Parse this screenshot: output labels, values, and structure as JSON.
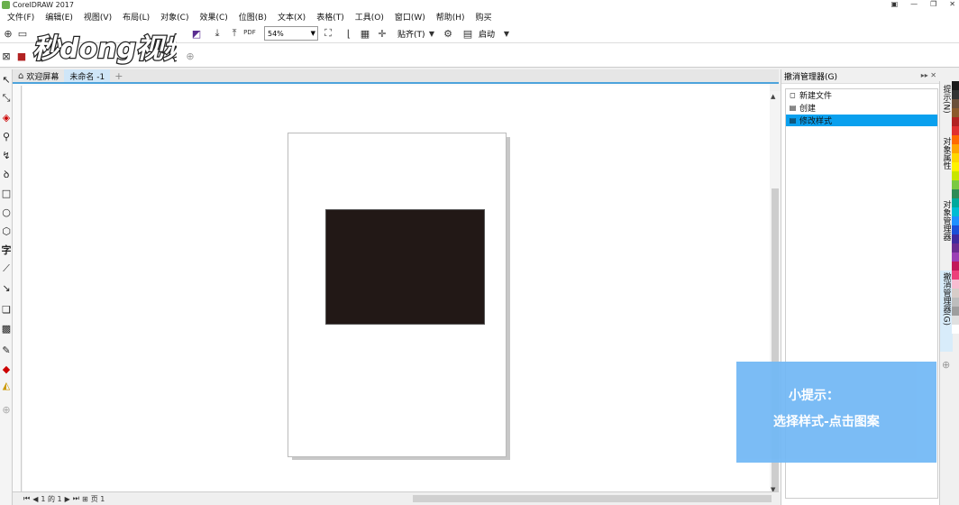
{
  "window": {
    "title": "CorelDRAW 2017"
  },
  "menubar": {
    "items": [
      "文件(F)",
      "编辑(E)",
      "视图(V)",
      "布局(L)",
      "对象(C)",
      "效果(C)",
      "位图(B)",
      "文本(X)",
      "表格(T)",
      "工具(O)",
      "窗口(W)",
      "帮助(H)",
      "购买"
    ]
  },
  "toolbar": {
    "zoom_value": "54%",
    "snap_label": "贴齐(T)",
    "launch_label": "启动",
    "pdf_label": "PDF"
  },
  "watermark": {
    "text": "秒dong视频"
  },
  "tabs": [
    {
      "label": "欢迎屏幕",
      "active": false
    },
    {
      "label": "未命名 -1",
      "active": true
    }
  ],
  "canvas": {
    "shape_color": "#221816",
    "page_color": "#ffffff"
  },
  "statusbar": {
    "page_nav": "1 的 1",
    "page_tab": "页 1"
  },
  "docker": {
    "title": "撤消管理器(G)",
    "undo_items": [
      {
        "label": "新建文件",
        "icon": "new-file-icon",
        "selected": false
      },
      {
        "label": "创建",
        "icon": "create-icon",
        "selected": false
      },
      {
        "label": "修改样式",
        "icon": "modify-style-icon",
        "selected": true
      }
    ]
  },
  "vertical_tabs": [
    {
      "label": "提示(N)",
      "active": false
    },
    {
      "label": "对象属性",
      "active": false
    },
    {
      "label": "对象管理器",
      "active": false
    },
    {
      "label": "撤消管理器(G)",
      "active": true
    }
  ],
  "palette": [
    "#1a1a1a",
    "#333333",
    "#6b4f3a",
    "#8b5a2b",
    "#b22222",
    "#e03030",
    "#ff6a00",
    "#ffa500",
    "#ffd700",
    "#fff200",
    "#c8e600",
    "#7ac943",
    "#2e8b57",
    "#00a99d",
    "#00bcd4",
    "#1e90ff",
    "#1b4fd8",
    "#3f2a9e",
    "#6a2c91",
    "#9b3fb5",
    "#c2185b",
    "#ec407a",
    "#f8bbd0",
    "#d7ccc8",
    "#bdbdbd",
    "#9e9e9e",
    "#e0e0e0",
    "#ffffff"
  ],
  "tip": {
    "title": "小提示：",
    "body": "选择样式-点击图案"
  }
}
